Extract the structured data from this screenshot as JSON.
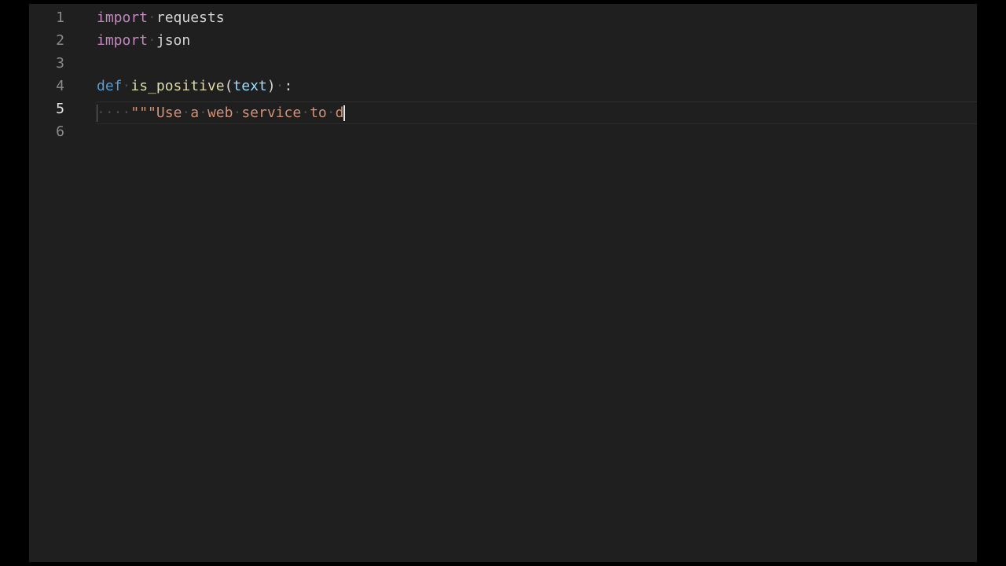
{
  "editor": {
    "line_numbers": [
      "1",
      "2",
      "3",
      "4",
      "5",
      "6"
    ],
    "active_line": "5",
    "lines": {
      "l1": {
        "keyword": "import",
        "module": "requests"
      },
      "l2": {
        "keyword": "import",
        "module": "json"
      },
      "l4": {
        "keyword": "def",
        "function": "is_positive",
        "open_paren": "(",
        "param": "text",
        "close_paren": ")",
        "colon": ":"
      },
      "l5": {
        "docstring": "\"\"\"Use a web service to d"
      }
    },
    "colors": {
      "background": "#1f1f1f",
      "keyword_import": "#c586c0",
      "keyword_def": "#569cd6",
      "function_name": "#dcdcaa",
      "parameter": "#9cdcfe",
      "string": "#ce9178"
    }
  }
}
